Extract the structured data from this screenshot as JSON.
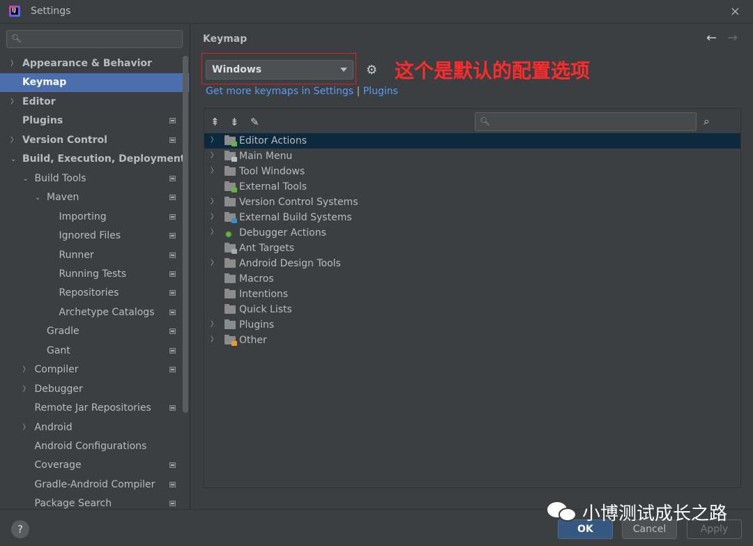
{
  "window": {
    "title": "Settings",
    "close_icon": "×"
  },
  "sidebar": {
    "search_placeholder": "",
    "items": [
      {
        "label": "Appearance & Behavior",
        "arrow": "›",
        "bold": true
      },
      {
        "label": "Keymap",
        "arrow": "",
        "bold": true,
        "selected": true
      },
      {
        "label": "Editor",
        "arrow": "›",
        "bold": true
      },
      {
        "label": "Plugins",
        "arrow": "",
        "bold": true,
        "badge": true
      },
      {
        "label": "Version Control",
        "arrow": "›",
        "bold": true,
        "badge": true
      },
      {
        "label": "Build, Execution, Deployment",
        "arrow": "⌄",
        "bold": true
      },
      {
        "label": "Build Tools",
        "arrow": "⌄",
        "badge": true
      },
      {
        "label": "Maven",
        "arrow": "⌄",
        "badge": true
      },
      {
        "label": "Importing",
        "badge": true
      },
      {
        "label": "Ignored Files",
        "badge": true
      },
      {
        "label": "Runner",
        "badge": true
      },
      {
        "label": "Running Tests",
        "badge": true
      },
      {
        "label": "Repositories",
        "badge": true
      },
      {
        "label": "Archetype Catalogs",
        "badge": true
      },
      {
        "label": "Gradle",
        "badge": true
      },
      {
        "label": "Gant",
        "badge": true
      },
      {
        "label": "Compiler",
        "arrow": "›",
        "badge": true
      },
      {
        "label": "Debugger",
        "arrow": "›"
      },
      {
        "label": "Remote Jar Repositories",
        "badge": true
      },
      {
        "label": "Android",
        "arrow": "›"
      },
      {
        "label": "Android Configurations"
      },
      {
        "label": "Coverage",
        "badge": true
      },
      {
        "label": "Gradle-Android Compiler",
        "badge": true
      },
      {
        "label": "Package Search",
        "badge": true
      }
    ]
  },
  "main": {
    "title": "Keymap",
    "nav_back": "←",
    "nav_forward": "→",
    "keymap_selected": "Windows",
    "gear_icon": "⚙",
    "annotation": "这个是默认的配置选项",
    "links": {
      "more": "Get more keymaps in Settings",
      "sep": " | ",
      "plugins": "Plugins"
    },
    "toolbar": {
      "expand_all": "⇞",
      "collapse_all": "⇟",
      "edit": "✎",
      "find_shortcut": "⌕"
    },
    "actions": [
      {
        "label": "Editor Actions",
        "arrow": "›",
        "icon": "folder",
        "mark": "#62b543",
        "selected": true
      },
      {
        "label": "Main Menu",
        "arrow": "›",
        "icon": "folder",
        "mark": "#c0c0c0"
      },
      {
        "label": "Tool Windows",
        "arrow": "›",
        "icon": "folder"
      },
      {
        "label": "External Tools",
        "arrow": "",
        "icon": "folder",
        "mark": "#62b543"
      },
      {
        "label": "Version Control Systems",
        "arrow": "›",
        "icon": "folder"
      },
      {
        "label": "External Build Systems",
        "arrow": "›",
        "icon": "folder",
        "mark": "#3592c4"
      },
      {
        "label": "Debugger Actions",
        "arrow": "›",
        "icon": "bug"
      },
      {
        "label": "Ant Targets",
        "arrow": "",
        "icon": "folder",
        "mark": "#aaaaaa"
      },
      {
        "label": "Android Design Tools",
        "arrow": "›",
        "icon": "folder"
      },
      {
        "label": "Macros",
        "arrow": "",
        "icon": "folder"
      },
      {
        "label": "Intentions",
        "arrow": "",
        "icon": "folder"
      },
      {
        "label": "Quick Lists",
        "arrow": "",
        "icon": "folder"
      },
      {
        "label": "Plugins",
        "arrow": "›",
        "icon": "folder"
      },
      {
        "label": "Other",
        "arrow": "›",
        "icon": "folder",
        "mark": "#e0a030"
      }
    ]
  },
  "footer": {
    "help": "?",
    "ok": "OK",
    "cancel": "Cancel",
    "apply": "Apply"
  },
  "watermark": {
    "text": "小博测试成长之路"
  }
}
